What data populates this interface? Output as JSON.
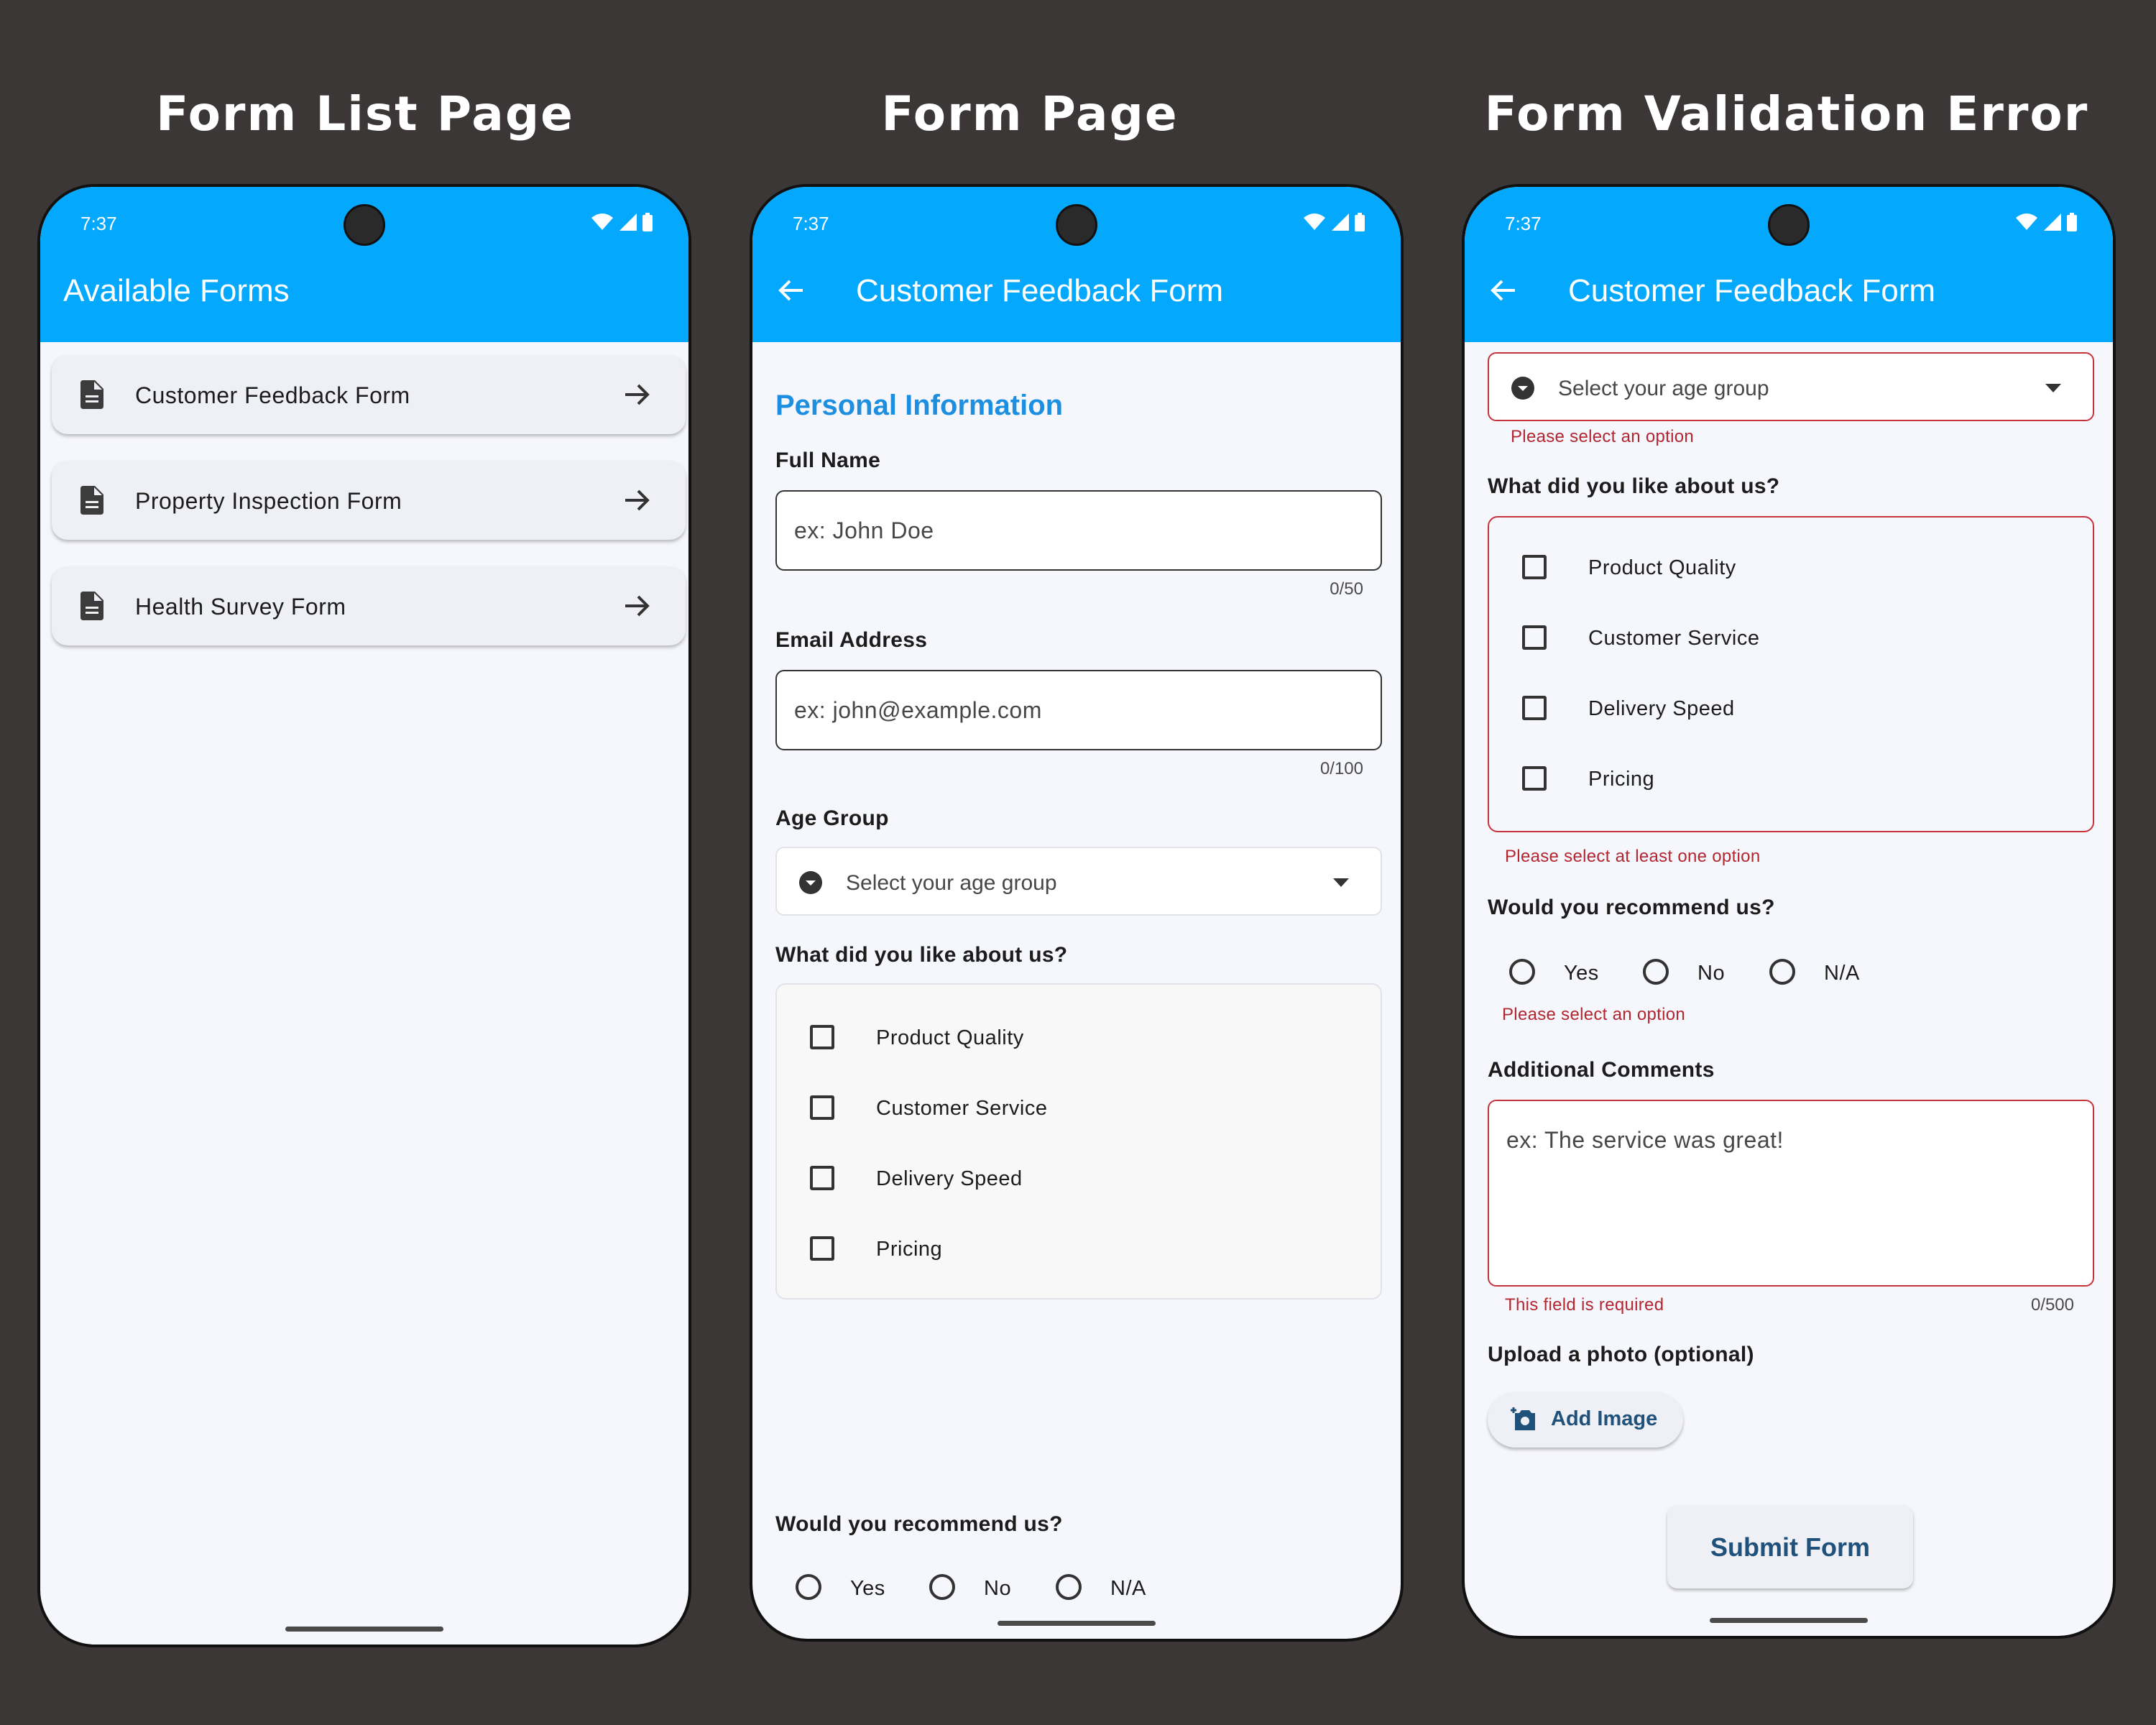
{
  "captions": {
    "list": "Form List Page",
    "form": "Form Page",
    "error": "Form Validation Error"
  },
  "status": {
    "time": "7:37"
  },
  "list_page": {
    "title": "Available Forms",
    "items": [
      {
        "label": "Customer Feedback Form"
      },
      {
        "label": "Property Inspection Form"
      },
      {
        "label": "Health Survey Form"
      }
    ]
  },
  "form": {
    "title": "Customer Feedback Form",
    "section": "Personal Information",
    "full_name": {
      "label": "Full Name",
      "placeholder": "ex: John Doe",
      "counter": "0/50"
    },
    "email": {
      "label": "Email Address",
      "placeholder": "ex: john@example.com",
      "counter": "0/100"
    },
    "age": {
      "label": "Age Group",
      "placeholder": "Select your age group"
    },
    "like": {
      "label": "What did you like about us?",
      "options": [
        "Product Quality",
        "Customer Service",
        "Delivery Speed",
        "Pricing"
      ]
    },
    "recommend": {
      "label": "Would you recommend us?",
      "options": [
        "Yes",
        "No",
        "N/A"
      ]
    },
    "comments": {
      "label": "Additional Comments",
      "placeholder": "ex: The service was great!",
      "counter": "0/500"
    },
    "photo": {
      "label": "Upload a photo (optional)",
      "button": "Add Image"
    },
    "submit": "Submit Form"
  },
  "errors": {
    "select_option": "Please select an option",
    "select_one": "Please select at least one option",
    "radio": "Please select an option",
    "required": "This field is required"
  },
  "colors": {
    "background": "#3b3736",
    "appbar": "#04a8fd",
    "section_title": "#1c8fe0",
    "error": "#b3262f",
    "button_text": "#20517a"
  },
  "icons": {
    "doc": "description-icon",
    "arrow": "arrow-forward-icon",
    "back": "arrow-back-icon",
    "camera": "add-a-photo-icon"
  }
}
